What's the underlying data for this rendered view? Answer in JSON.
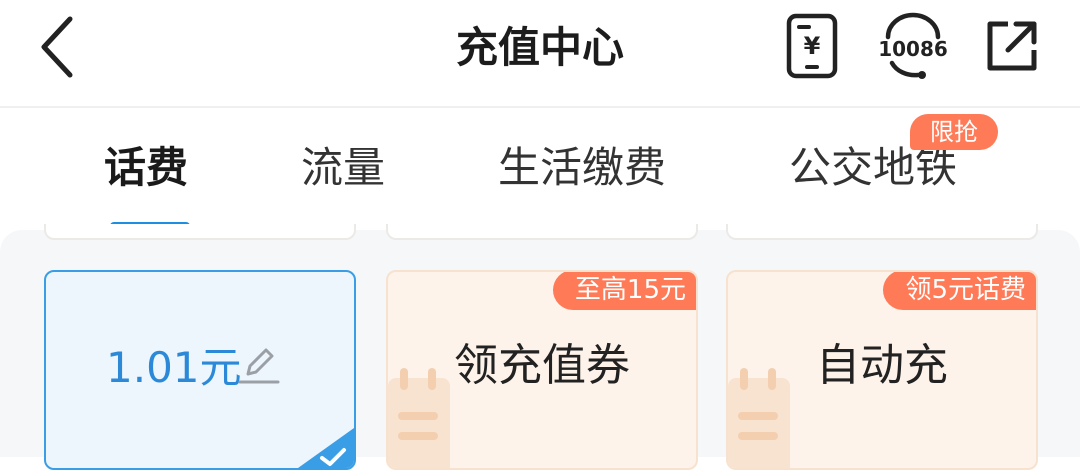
{
  "header": {
    "title": "充值中心",
    "bill_icon_glyph": "¥",
    "service_number": "10086"
  },
  "tabs": {
    "items": [
      {
        "label": "话费",
        "active": true
      },
      {
        "label": "流量",
        "active": false
      },
      {
        "label": "生活缴费",
        "active": false
      },
      {
        "label": "公交地铁",
        "active": false,
        "badge": "限抢"
      }
    ]
  },
  "cards": [
    {
      "label": "1.01元",
      "selected": true
    },
    {
      "label": "领充值券",
      "tag": "至高15元"
    },
    {
      "label": "自动充",
      "tag": "领5元话费"
    }
  ],
  "colors": {
    "accent": "#1e8fe0",
    "tag_bg": "#ff7a57",
    "selected_border": "#3a9ee6",
    "card_warm_bg": "#fdf3ea"
  }
}
